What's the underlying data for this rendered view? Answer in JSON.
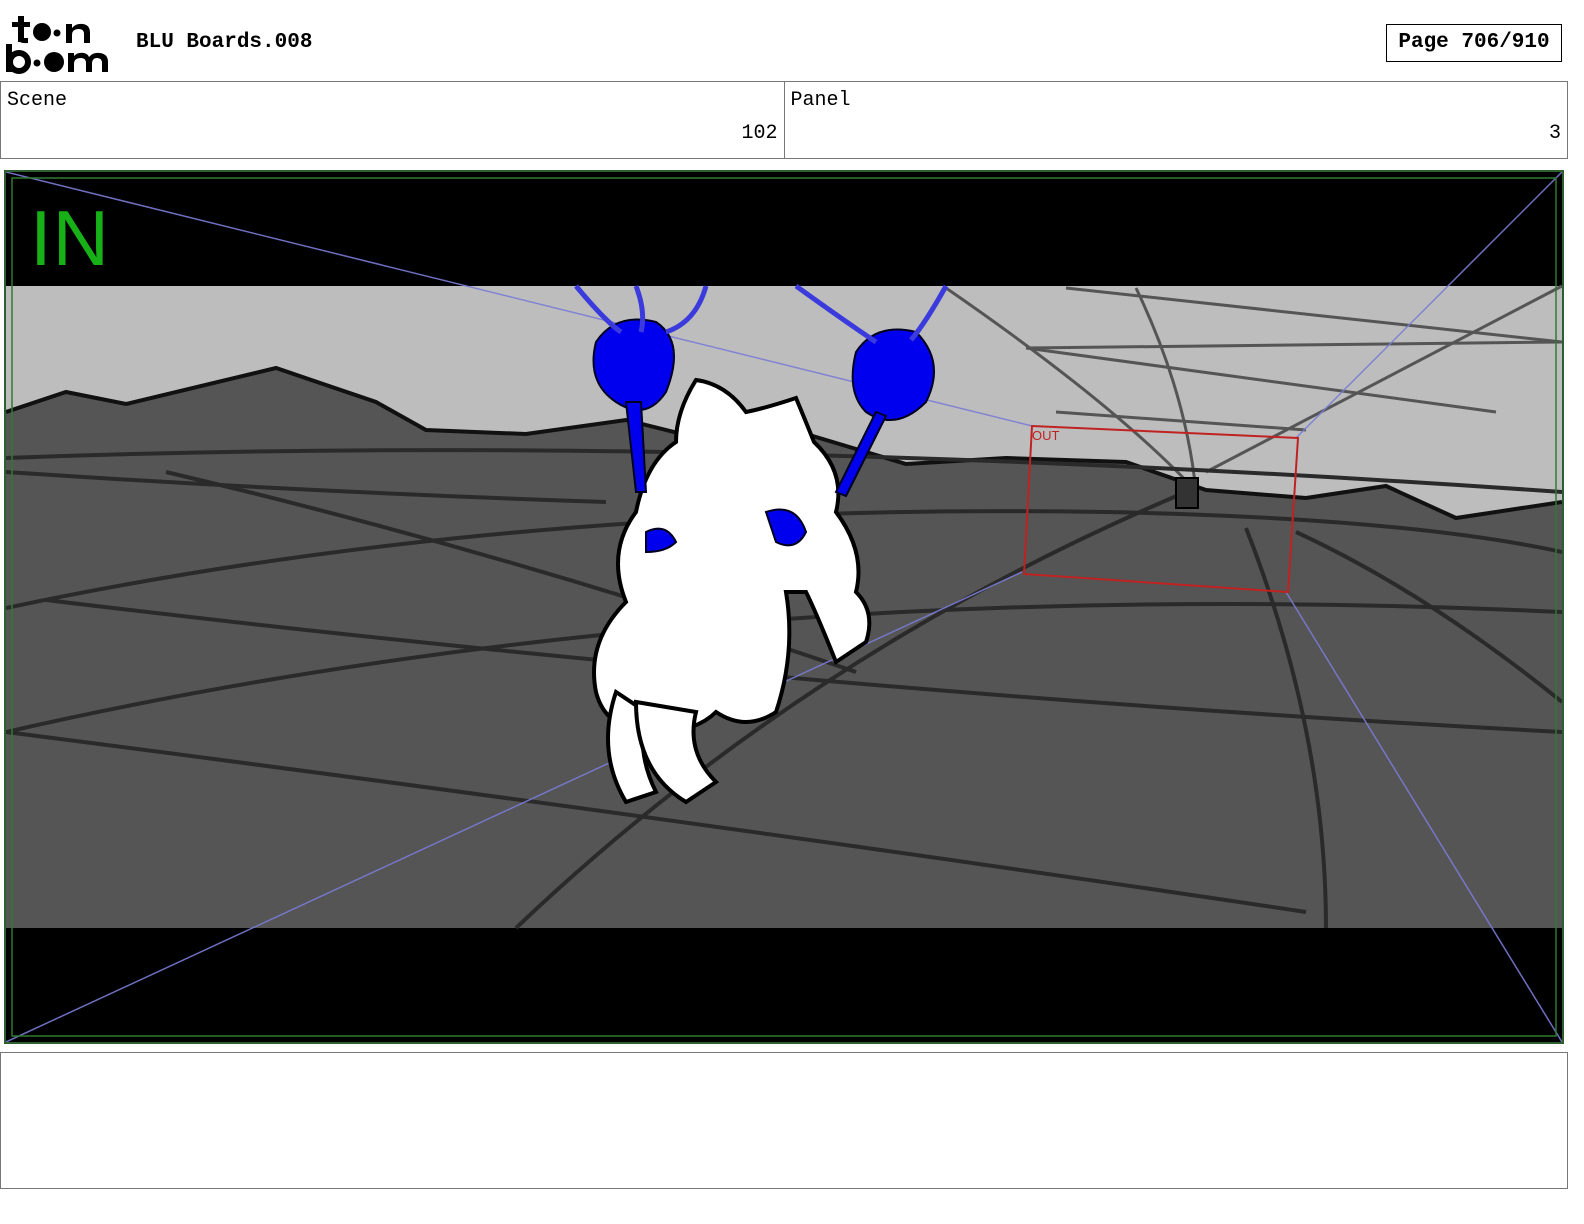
{
  "header": {
    "logo_top": "t●n",
    "logo_bottom": "b●m",
    "title": "BLU Boards.008",
    "page_indicator": "Page 706/910"
  },
  "info": {
    "scene_label": "Scene",
    "scene_value": "102",
    "panel_label": "Panel",
    "panel_value": "3"
  },
  "frame": {
    "in_label": "IN",
    "out_label": "OUT"
  },
  "notes": {
    "text": ""
  },
  "colors": {
    "in_label": "#17b117",
    "out_frame": "#c02222",
    "effect_blue": "#0000ee",
    "ground": "#555555",
    "sky": "#bdbdbd",
    "frame_border": "#2f5e2f"
  }
}
